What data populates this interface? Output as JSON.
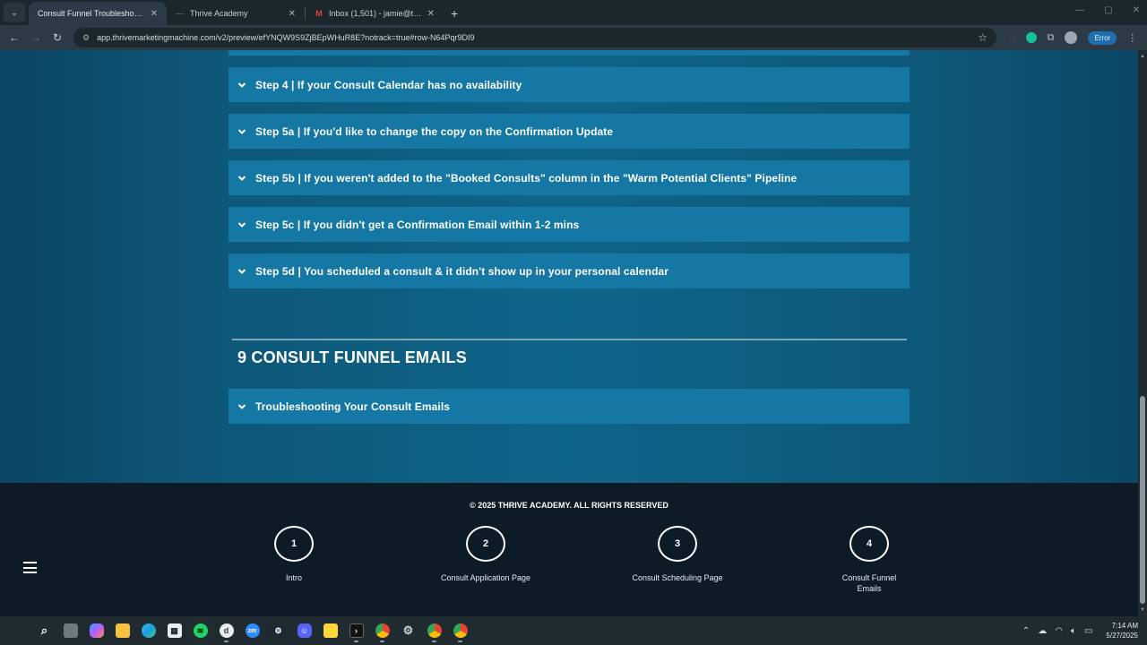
{
  "browser": {
    "tabs": [
      {
        "title": "Consult Funnel Troubleshooting",
        "active": true,
        "favicon": "none"
      },
      {
        "title": "Thrive Academy",
        "active": false,
        "favicon": "dash-icon"
      },
      {
        "title": "Inbox (1,501) - jamie@thrive-a...",
        "active": false,
        "favicon": "gmail-icon"
      }
    ],
    "new_tab": "+",
    "url": "app.thrivemarketingmachine.com/v2/preview/efYNQW9S9ZjBEpWHuR8E?notrack=true#row-N64Pqr9DI9",
    "error_label": "Error"
  },
  "accordions": [
    {
      "label": "Step 4 | If your Consult Calendar has no availability"
    },
    {
      "label": "Step 5a | If you'd like to change the copy on the Confirmation Update"
    },
    {
      "label": "Step 5b | If you weren't added to the \"Booked Consults\" column in the \"Warm Potential Clients\" Pipeline"
    },
    {
      "label": "Step 5c | If you didn't get a Confirmation Email within 1-2 mins"
    },
    {
      "label": "Step 5d | You scheduled a consult & it didn't show up in your personal calendar"
    }
  ],
  "section": {
    "title": "9 CONSULT FUNNEL EMAILS",
    "accordions": [
      {
        "label": "Troubleshooting Your Consult Emails"
      }
    ]
  },
  "footer": {
    "copyright": "© 2025 THRIVE ACADEMY. ALL RIGHTS RESERVED",
    "steps": [
      {
        "number": "1",
        "label": "Intro"
      },
      {
        "number": "2",
        "label": "Consult Application Page"
      },
      {
        "number": "3",
        "label": "Consult Scheduling Page"
      },
      {
        "number": "4",
        "label": "Consult Funnel Emails"
      }
    ]
  },
  "taskbar": {
    "time": "7:14 AM",
    "date": "5/27/2025"
  },
  "colors": {
    "accordion_bg": "#1577a3",
    "page_bg": "#0f6589",
    "footer_bg": "#0d1b26"
  }
}
